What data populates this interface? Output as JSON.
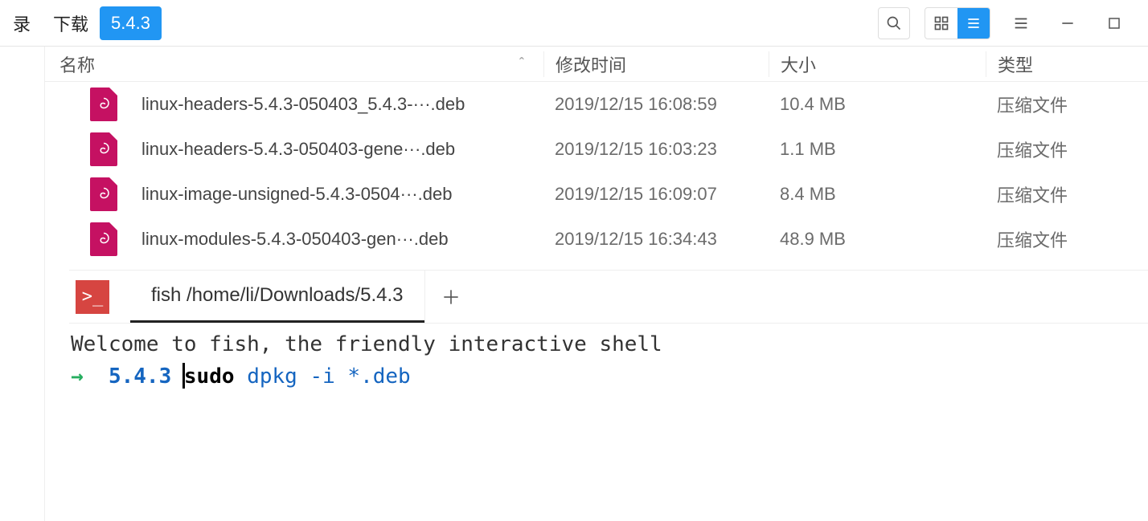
{
  "breadcrumbs": [
    "录",
    "下载",
    "5.4.3"
  ],
  "active_crumb_index": 2,
  "columns": {
    "name": "名称",
    "mtime": "修改时间",
    "size": "大小",
    "type": "类型",
    "sort_indicator": "ˆ"
  },
  "files": [
    {
      "name": "linux-headers-5.4.3-050403_5.4.3-···.deb",
      "mtime": "2019/12/15 16:08:59",
      "size": "10.4 MB",
      "type": "压缩文件"
    },
    {
      "name": "linux-headers-5.4.3-050403-gene···.deb",
      "mtime": "2019/12/15 16:03:23",
      "size": "1.1 MB",
      "type": "压缩文件"
    },
    {
      "name": "linux-image-unsigned-5.4.3-0504···.deb",
      "mtime": "2019/12/15 16:09:07",
      "size": "8.4 MB",
      "type": "压缩文件"
    },
    {
      "name": "linux-modules-5.4.3-050403-gen···.deb",
      "mtime": "2019/12/15 16:34:43",
      "size": "48.9 MB",
      "type": "压缩文件"
    }
  ],
  "terminal": {
    "app_glyph": ">_",
    "tab_title": "fish /home/li/Downloads/5.4.3",
    "welcome": "Welcome to fish, the friendly interactive shell",
    "prompt_arrow": "→",
    "prompt_dir": "5.4.3",
    "cmd_sudo": "sudo",
    "cmd_rest": "dpkg -i *.deb"
  }
}
